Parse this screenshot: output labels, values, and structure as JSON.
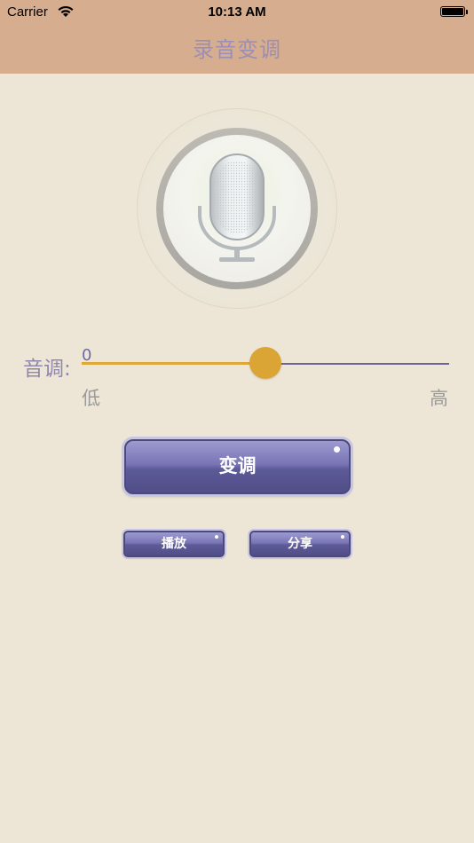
{
  "status_bar": {
    "carrier": "Carrier",
    "time": "10:13 AM"
  },
  "nav": {
    "title": "录音变调"
  },
  "pitch": {
    "label": "音调:",
    "value": "0",
    "low_label": "低",
    "high_label": "高",
    "level": 0.5
  },
  "buttons": {
    "transform": "变调",
    "play": "播放",
    "share": "分享"
  },
  "colors": {
    "header": "#d6ad8f",
    "background": "#ede6d6",
    "accent": "#dba536",
    "button": "#5d5a98"
  },
  "icons": {
    "record": "microphone-icon",
    "wifi": "wifi-icon",
    "battery": "battery-icon"
  }
}
